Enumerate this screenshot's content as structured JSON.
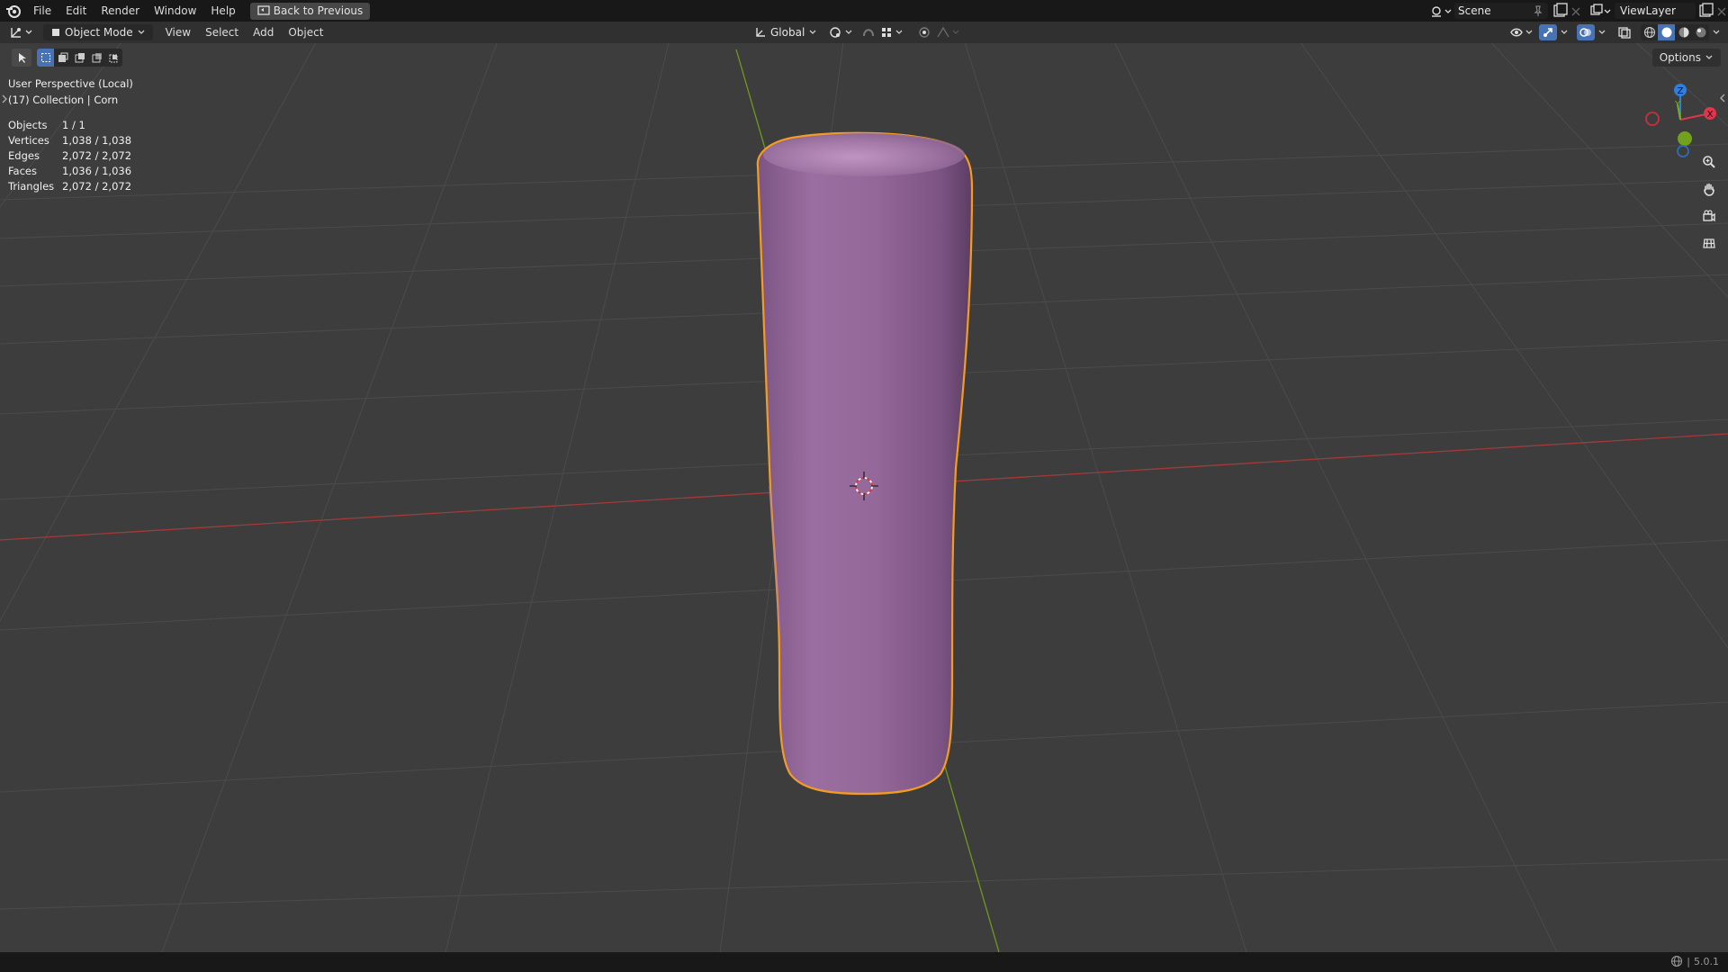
{
  "topbar": {
    "menus": [
      "File",
      "Edit",
      "Render",
      "Window",
      "Help"
    ],
    "back_label": "Back to Previous",
    "scene_label": "Scene",
    "viewlayer_label": "ViewLayer"
  },
  "header": {
    "mode_label": "Object Mode",
    "menus": [
      "View",
      "Select",
      "Add",
      "Object"
    ],
    "transform_orientation": "Global",
    "options_label": "Options"
  },
  "overlay": {
    "view_name": "User Perspective (Local)",
    "collection": "(17) Collection | Corn",
    "stats": [
      {
        "label": "Objects",
        "value": "1 / 1"
      },
      {
        "label": "Vertices",
        "value": "1,038 / 1,038"
      },
      {
        "label": "Edges",
        "value": "2,072 / 2,072"
      },
      {
        "label": "Faces",
        "value": "1,036 / 1,036"
      },
      {
        "label": "Triangles",
        "value": "2,072 / 2,072"
      }
    ]
  },
  "gizmo": {
    "z": "Z",
    "y": "Y",
    "x": "X"
  },
  "statusbar": {
    "version": "5.0.1"
  },
  "colors": {
    "object": "#9a6aa0",
    "selection_outline": "#f5a623",
    "x_axis": "#c0392b",
    "y_axis": "#7ab317",
    "viewport_bg": "#3d3d3d"
  }
}
